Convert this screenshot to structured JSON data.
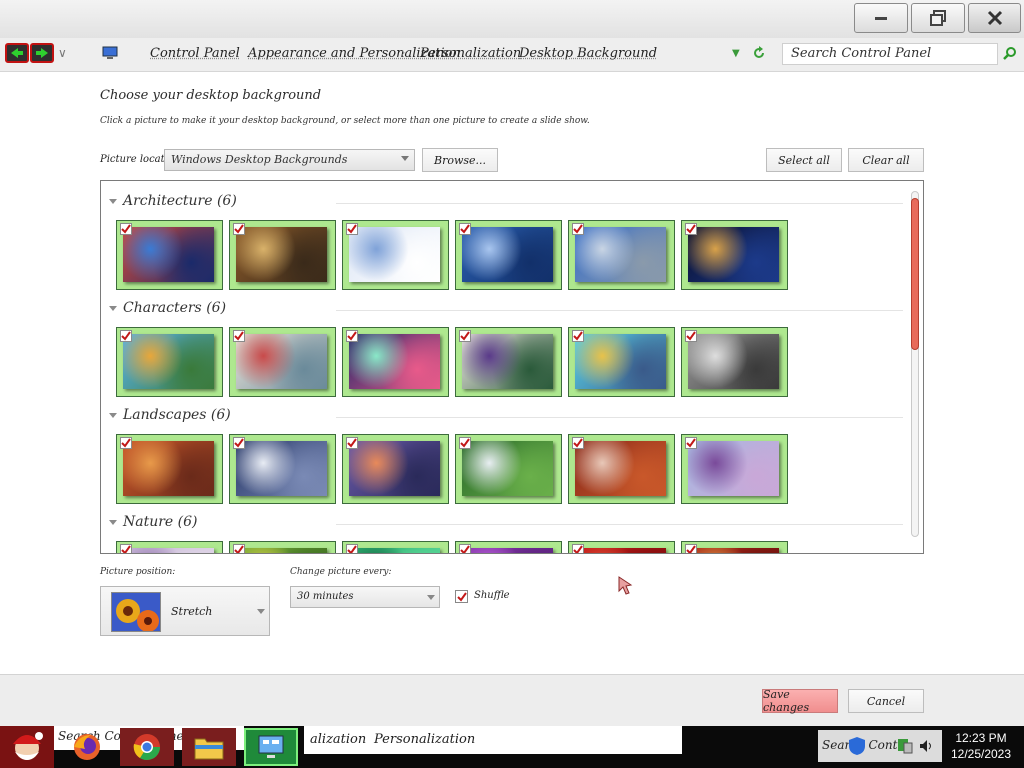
{
  "window": {
    "minimize_label": "minimize",
    "maximize_label": "restore",
    "close_label": "close"
  },
  "address_bar": {
    "breadcrumbs": [
      "Control Panel",
      "Appearance and Personalization",
      "Personalization",
      "Desktop Background"
    ],
    "search_placeholder": "Search Control Panel"
  },
  "content": {
    "heading": "Choose your desktop background",
    "subheading": "Click a picture to make it your desktop background, or select more than one picture to create a slide show.",
    "picture_location_label": "Picture location:",
    "picture_location_value": "Windows Desktop Backgrounds",
    "browse_label": "Browse...",
    "select_all_label": "Select all",
    "clear_all_label": "Clear all"
  },
  "gallery": {
    "groups": [
      {
        "name": "Architecture",
        "count": "(6)",
        "images": [
          {
            "palette": [
              "#d24a3a",
              "#3a7bd5",
              "#1a2a6a"
            ],
            "checked": true
          },
          {
            "palette": [
              "#8a5a2a",
              "#d9b26a",
              "#3a2a1a"
            ],
            "checked": true
          },
          {
            "palette": [
              "#dde6f5",
              "#7fa2d8",
              "#ffffff"
            ],
            "checked": true
          },
          {
            "palette": [
              "#2a5fb0",
              "#a9c6ef",
              "#12306a"
            ],
            "checked": true
          },
          {
            "palette": [
              "#3a6fc7",
              "#c9d5e4",
              "#8a9aab"
            ],
            "checked": true
          },
          {
            "palette": [
              "#0a1030",
              "#d9a24a",
              "#1c3a8a"
            ],
            "checked": true
          }
        ]
      },
      {
        "name": "Characters",
        "count": "(6)",
        "images": [
          {
            "palette": [
              "#5ab3e8",
              "#e8a73a",
              "#3a7a3a"
            ],
            "checked": true
          },
          {
            "palette": [
              "#e8e2d8",
              "#c94a4a",
              "#6a8a9a"
            ],
            "checked": true
          },
          {
            "palette": [
              "#2a2a6a",
              "#8ae8c8",
              "#e85a8a"
            ],
            "checked": true
          },
          {
            "palette": [
              "#ece6e0",
              "#5a3a8a",
              "#2a5a3a"
            ],
            "checked": true
          },
          {
            "palette": [
              "#5ad2e8",
              "#e8c24a",
              "#3a5a8a"
            ],
            "checked": true
          },
          {
            "palette": [
              "#9a9a9a",
              "#dedede",
              "#3a3a3a"
            ],
            "checked": true
          }
        ]
      },
      {
        "name": "Landscapes",
        "count": "(6)",
        "images": [
          {
            "palette": [
              "#c9582a",
              "#e89a4a",
              "#6a2a1a"
            ],
            "checked": true
          },
          {
            "palette": [
              "#2a3a6a",
              "#e8ecf4",
              "#7a8ab5"
            ],
            "checked": true
          },
          {
            "palette": [
              "#6a5aa8",
              "#e88a5a",
              "#2a2a5a"
            ],
            "checked": true
          },
          {
            "palette": [
              "#2a6a2a",
              "#e8eef2",
              "#6ab04a"
            ],
            "checked": true
          },
          {
            "palette": [
              "#8a2a1a",
              "#e8c8b8",
              "#c9582a"
            ],
            "checked": true
          },
          {
            "palette": [
              "#a8b8e0",
              "#7a4a9a",
              "#c9a8d8"
            ],
            "checked": true
          }
        ]
      },
      {
        "name": "Nature",
        "count": "(6)",
        "images": [
          {
            "palette": [
              "#c8b8d8",
              "#8a6aa8",
              "#e8e0ec"
            ],
            "checked": true
          },
          {
            "palette": [
              "#7ab03a",
              "#e8d84a",
              "#2a5a1a"
            ],
            "checked": true
          },
          {
            "palette": [
              "#2aa86a",
              "#0a5a3a",
              "#6ae8a8"
            ],
            "checked": true
          },
          {
            "palette": [
              "#8a3ab0",
              "#c96ae8",
              "#4a1a6a"
            ],
            "checked": true
          },
          {
            "palette": [
              "#c91a1a",
              "#e85a3a",
              "#6a0a0a"
            ],
            "checked": true
          },
          {
            "palette": [
              "#b02a1a",
              "#e8a84a",
              "#5a0a0a"
            ],
            "checked": true
          }
        ]
      }
    ]
  },
  "bottom": {
    "picture_position_label": "Picture position:",
    "picture_position_value": "Stretch",
    "interval_label": "Change picture every:",
    "interval_value": "30 minutes",
    "shuffle_label": "Shuffle",
    "shuffle_checked": true
  },
  "footer": {
    "save_label": "Save changes",
    "cancel_label": "Cancel"
  },
  "taskbar": {
    "ghost_text": "Search Control Panel",
    "mid_text_1": "alization",
    "mid_text_2": "Personalization",
    "tray_text": "Search Cont",
    "time": "12:23 PM",
    "date": "12/25/2023"
  },
  "colors": {
    "tile_bg": "#aee88f",
    "save_button": "#f3a0a0",
    "scroll_thumb": "#e86a5a"
  }
}
